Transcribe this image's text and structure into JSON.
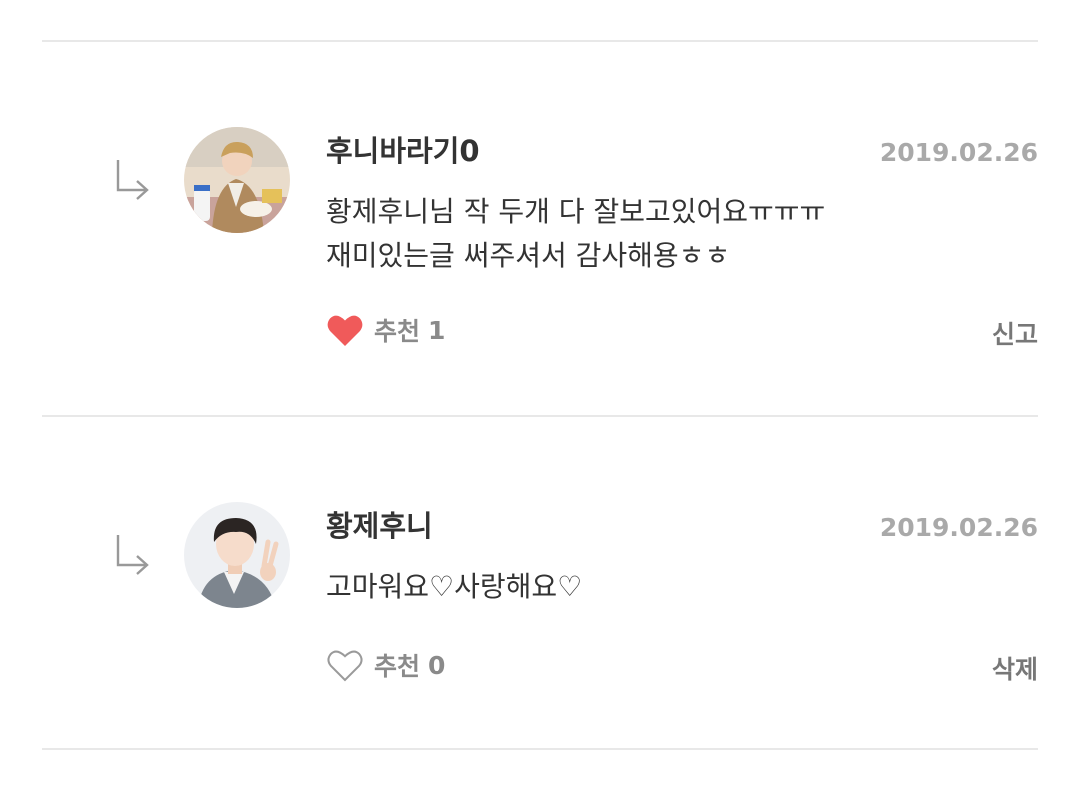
{
  "comments": [
    {
      "author": "후니바라기0",
      "date": "2019.02.26",
      "lines": [
        "황제후니님 작 두개 다 잘보고있어요ㅠㅠㅠ",
        "재미있는글 써주셔서 감사해용ㅎㅎ"
      ],
      "like_label": "추천",
      "like_count": "1",
      "liked": true,
      "action_label": "신고"
    },
    {
      "author": "황제후니",
      "date": "2019.02.26",
      "lines": [
        "고마워요♡사랑해요♡"
      ],
      "like_label": "추천",
      "like_count": "0",
      "liked": false,
      "action_label": "삭제"
    }
  ],
  "colors": {
    "heart_filled": "#f05a5a",
    "heart_outline": "#9a9a9a",
    "date": "#a9a9a9",
    "divider": "#e8e8e8"
  }
}
